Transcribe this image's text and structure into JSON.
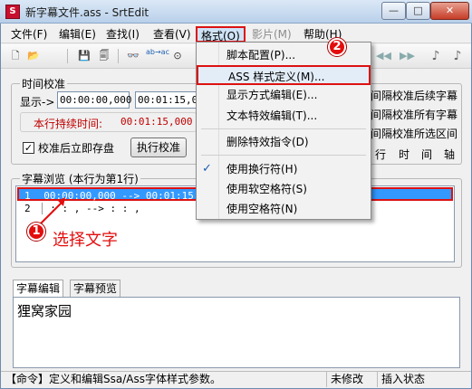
{
  "window": {
    "title": "新字幕文件.ass - SrtEdit",
    "app_icon_glyph": "S"
  },
  "title_buttons": {
    "min": "—",
    "max": "□",
    "close": "✕"
  },
  "menubar": {
    "file": "文件(F)",
    "edit": "编辑(E)",
    "find": "查找(I)",
    "view": "查看(V)",
    "format": "格式(O)",
    "video": "影片(M)",
    "help": "帮助(H)"
  },
  "toolbar": {
    "icons": [
      "new-file-icon",
      "open-folder-icon",
      "save-icon",
      "save-all-icon",
      "find-icon",
      "replace-icon",
      "preview-icon"
    ],
    "glyphs": {
      "new": "🗋",
      "open": "📂",
      "save": "💾",
      "saveall": "🗐",
      "find": "👓",
      "replace": "ab→ac",
      "preview": "⊙",
      "prev": "◀◀",
      "next": "▶▶",
      "tool1": "♪",
      "tool2": "♪"
    }
  },
  "calibration": {
    "group_title": "时间校准",
    "display_label": "显示->",
    "start_time": "00:00:00,000",
    "end_time": "00:01:15,00",
    "duration_label": "本行持续时间:",
    "duration_value": "00:01:15,000",
    "checkbox_label": "校准后立即存盘",
    "checkbox_checked": "✓",
    "execute_button": "执行校准",
    "right_options": [
      "间隔校准后续字幕",
      "间隔校准所有字幕",
      "间隔校准所选区间"
    ],
    "right_axis": [
      "行",
      "时",
      "间",
      "轴"
    ]
  },
  "subtitle_browser": {
    "group_title": "字幕浏览 (本行为第1行)",
    "rows": [
      {
        "num": "1",
        "text": "00:00:00,000 --> 00:01:15,00"
      },
      {
        "num": "2",
        "text": " :  :  ,     -->  :  :  ,"
      }
    ]
  },
  "annotation": {
    "step1_num": "1",
    "step1_text": "选择文字",
    "step2_num": "2",
    "color": "#e30d0d"
  },
  "editor": {
    "tabs": [
      "字幕编辑",
      "字幕预览"
    ],
    "content": "狸窝家园"
  },
  "statusbar": {
    "command": "【命令】定义和编辑Ssa/Ass字体样式参数。",
    "modified": "未修改",
    "mode": "插入状态"
  },
  "format_menu": {
    "items": [
      {
        "label": "脚本配置(P)...",
        "checked": false
      },
      {
        "label": "ASS 样式定义(M)...",
        "checked": false
      },
      {
        "label": "显示方式编辑(E)...",
        "checked": false
      },
      {
        "label": "文本特效编辑(T)...",
        "checked": false
      },
      {
        "label": "删除特效指令(D)",
        "checked": false
      },
      {
        "label": "使用换行符(H)",
        "checked": true
      },
      {
        "label": "使用软空格符(S)",
        "checked": false
      },
      {
        "label": "使用空格符(N)",
        "checked": false
      }
    ],
    "check_glyph": "✓"
  },
  "colors": {
    "highlight_red": "#dd1111",
    "selection_blue": "#3399ff",
    "titlebar": "#c8d9ef"
  }
}
